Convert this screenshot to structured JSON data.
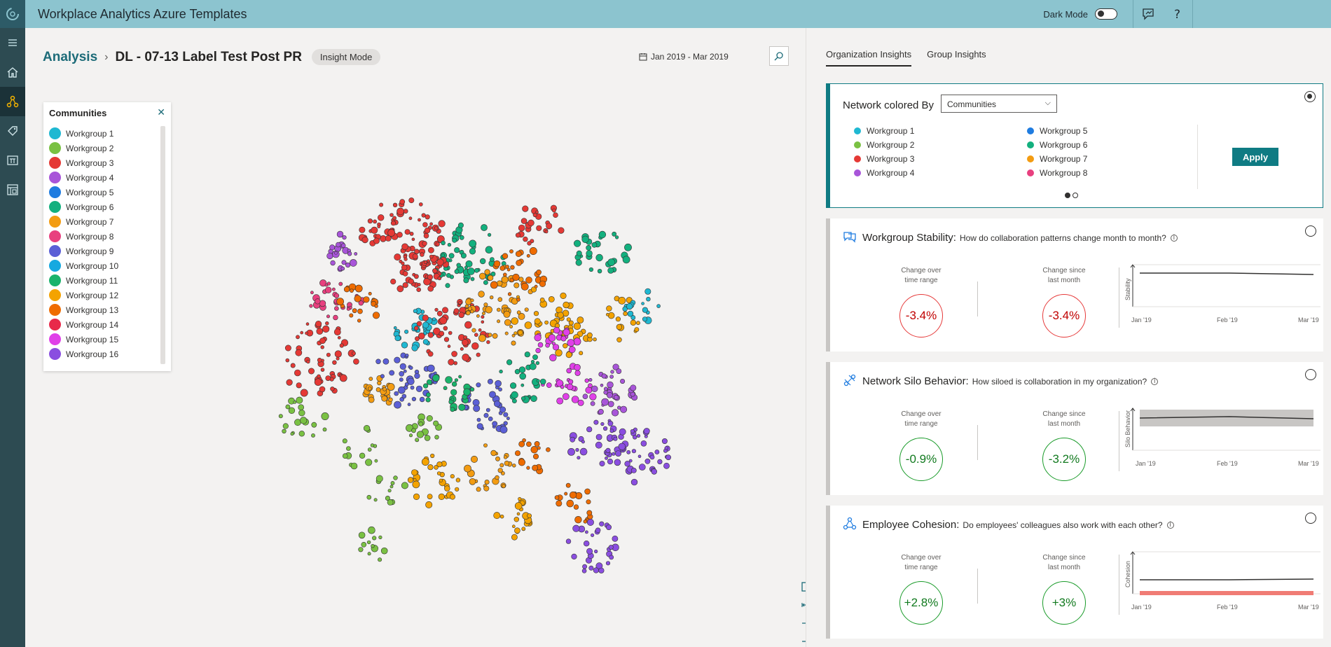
{
  "app": {
    "title": "Workplace Analytics Azure Templates",
    "dark_mode_label": "Dark Mode"
  },
  "breadcrumb": {
    "root": "Analysis",
    "current": "DL - 07-13 Label Test Post PR",
    "mode": "Insight Mode"
  },
  "date_range": "Jan 2019 - Mar 2019",
  "communities": {
    "title": "Communities",
    "items": [
      {
        "label": "Workgroup 1",
        "color": "#1fb8d2"
      },
      {
        "label": "Workgroup 2",
        "color": "#7ac143"
      },
      {
        "label": "Workgroup 3",
        "color": "#e53935"
      },
      {
        "label": "Workgroup 4",
        "color": "#a855d9"
      },
      {
        "label": "Workgroup 5",
        "color": "#1f7ce0"
      },
      {
        "label": "Workgroup 6",
        "color": "#13b07e"
      },
      {
        "label": "Workgroup 7",
        "color": "#f39c12"
      },
      {
        "label": "Workgroup 8",
        "color": "#e8407f"
      },
      {
        "label": "Workgroup 9",
        "color": "#5b5fd6"
      },
      {
        "label": "Workgroup 10",
        "color": "#16a9e0"
      },
      {
        "label": "Workgroup 11",
        "color": "#1ab36b"
      },
      {
        "label": "Workgroup 12",
        "color": "#f4a300"
      },
      {
        "label": "Workgroup 13",
        "color": "#ef6c00"
      },
      {
        "label": "Workgroup 14",
        "color": "#e8294a"
      },
      {
        "label": "Workgroup 15",
        "color": "#e040e8"
      },
      {
        "label": "Workgroup 16",
        "color": "#8a4ee0"
      }
    ]
  },
  "tabs": [
    "Organization Insights",
    "Group Insights"
  ],
  "network_card": {
    "label": "Network colored By",
    "selected": "Communities",
    "legend": [
      {
        "label": "Workgroup 1",
        "color": "#1fb8d2"
      },
      {
        "label": "Workgroup 2",
        "color": "#7ac143"
      },
      {
        "label": "Workgroup 3",
        "color": "#e53935"
      },
      {
        "label": "Workgroup 4",
        "color": "#a855d9"
      },
      {
        "label": "Workgroup 5",
        "color": "#1f7ce0"
      },
      {
        "label": "Workgroup 6",
        "color": "#13b07e"
      },
      {
        "label": "Workgroup 7",
        "color": "#f39c12"
      },
      {
        "label": "Workgroup 8",
        "color": "#e8407f"
      }
    ],
    "apply": "Apply"
  },
  "insights": [
    {
      "title": "Workgroup Stability:",
      "question": "How do collaboration patterns change month to month?",
      "change_time_label_1": "Change over",
      "change_time_label_2": "time range",
      "change_time_value": "-3.4%",
      "change_month_label_1": "Change since",
      "change_month_label_2": "last month",
      "change_month_value": "-3.4%",
      "y_axis": "Stability",
      "x_ticks": [
        "Jan '19",
        "Feb '19",
        "Mar '19"
      ],
      "status": "negative"
    },
    {
      "title": "Network Silo Behavior:",
      "question": "How siloed is collaboration in my organization?",
      "change_time_label_1": "Change over",
      "change_time_label_2": "time range",
      "change_time_value": "-0.9%",
      "change_month_label_1": "Change since",
      "change_month_label_2": "last month",
      "change_month_value": "-3.2%",
      "y_axis": "Silo Behavior",
      "x_ticks": [
        "Jan '19",
        "Feb '19",
        "Mar '19"
      ],
      "status": "positive"
    },
    {
      "title": "Employee Cohesion:",
      "question": "Do employees' colleagues also work with each other?",
      "change_time_label_1": "Change over",
      "change_time_label_2": "time range",
      "change_time_value": "+2.8%",
      "change_month_label_1": "Change since",
      "change_month_label_2": "last month",
      "change_month_value": "+3%",
      "y_axis": "Cohesion",
      "x_ticks": [
        "Jan '19",
        "Feb '19",
        "Mar '19"
      ],
      "status": "positive"
    }
  ]
}
